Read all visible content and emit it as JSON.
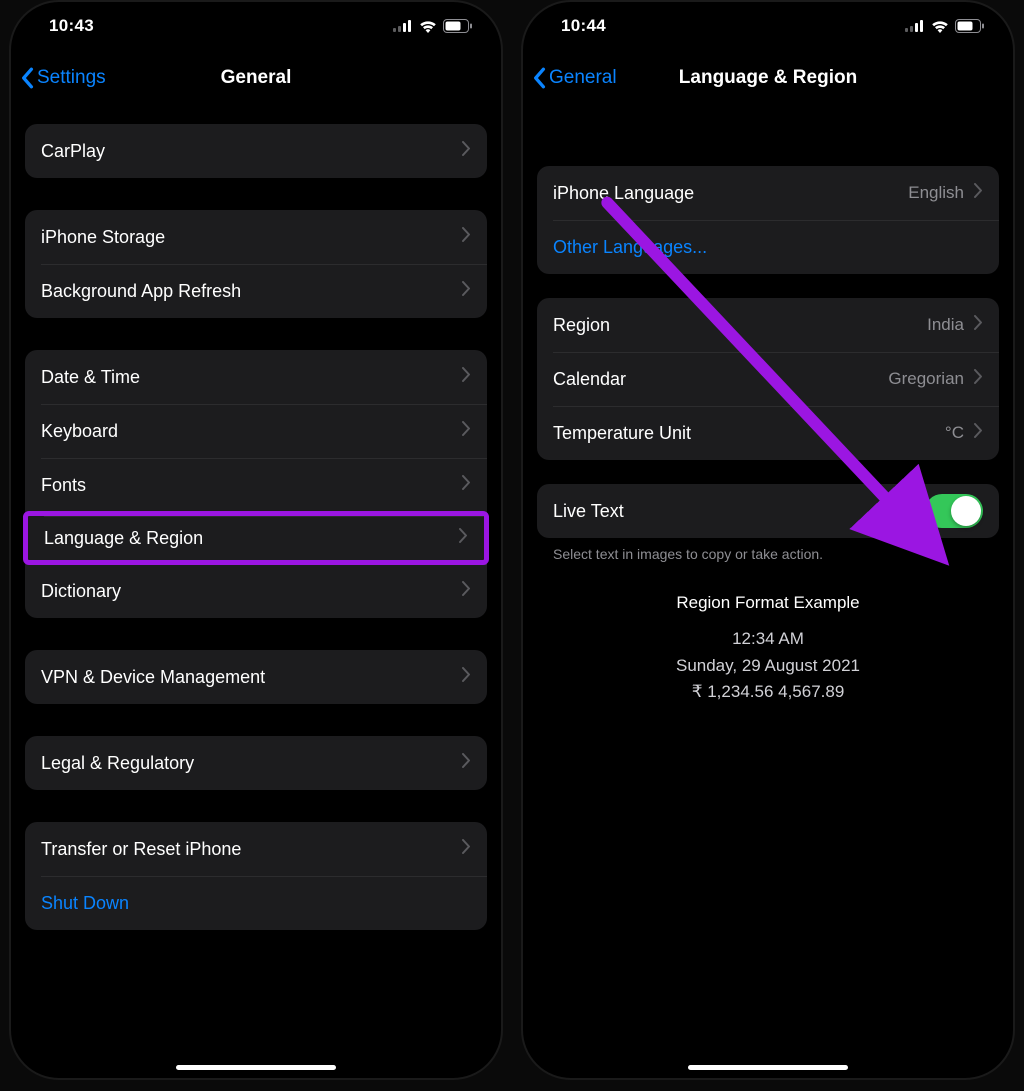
{
  "left": {
    "status": {
      "time": "10:43"
    },
    "nav": {
      "back": "Settings",
      "title": "General"
    },
    "groups": [
      {
        "items": [
          {
            "label": "CarPlay"
          }
        ]
      },
      {
        "items": [
          {
            "label": "iPhone Storage"
          },
          {
            "label": "Background App Refresh"
          }
        ]
      },
      {
        "items": [
          {
            "label": "Date & Time"
          },
          {
            "label": "Keyboard"
          },
          {
            "label": "Fonts"
          },
          {
            "label": "Language & Region",
            "highlighted": true
          },
          {
            "label": "Dictionary"
          }
        ]
      },
      {
        "items": [
          {
            "label": "VPN & Device Management"
          }
        ]
      },
      {
        "items": [
          {
            "label": "Legal & Regulatory"
          }
        ]
      },
      {
        "items": [
          {
            "label": "Transfer or Reset iPhone"
          },
          {
            "label": "Shut Down",
            "link": true,
            "no_chevron": true
          }
        ]
      }
    ]
  },
  "right": {
    "status": {
      "time": "10:44"
    },
    "nav": {
      "back": "General",
      "title": "Language & Region"
    },
    "lang_group": {
      "iphone_language_label": "iPhone Language",
      "iphone_language_value": "English",
      "other_languages": "Other Languages..."
    },
    "region_group": {
      "region_label": "Region",
      "region_value": "India",
      "calendar_label": "Calendar",
      "calendar_value": "Gregorian",
      "temp_label": "Temperature Unit",
      "temp_value": "°C"
    },
    "live_text": {
      "label": "Live Text",
      "on": true
    },
    "live_text_footer": "Select text in images to copy or take action.",
    "example": {
      "header": "Region Format Example",
      "time": "12:34 AM",
      "date": "Sunday, 29 August 2021",
      "numbers": "₹ 1,234.56   4,567.89"
    }
  }
}
